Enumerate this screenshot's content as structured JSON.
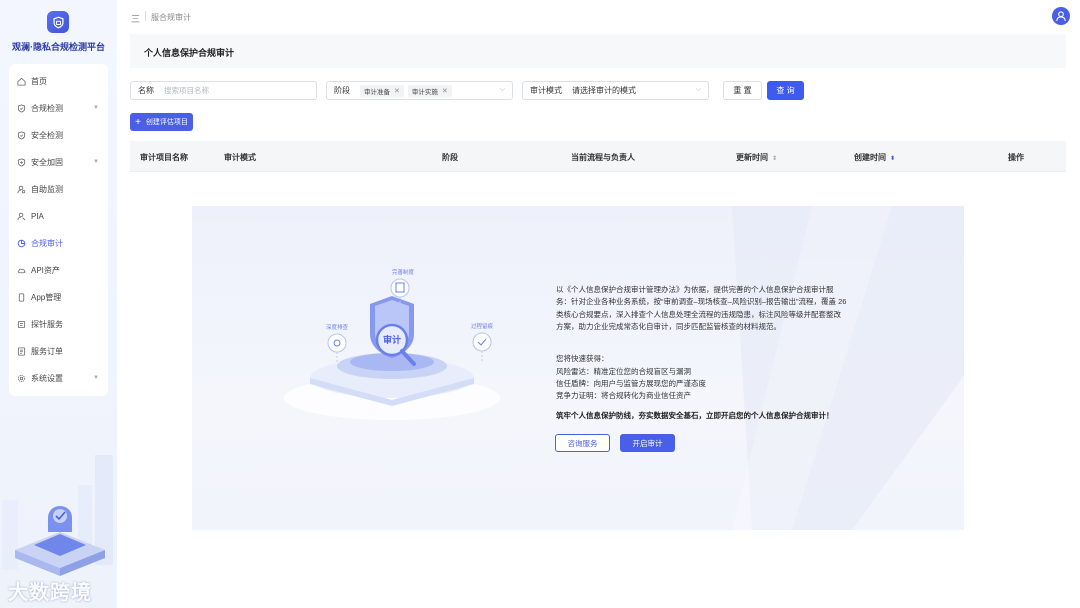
{
  "app": {
    "name": "观澜·隐私合规检测平台",
    "logo_icon": "shield-icon"
  },
  "sidebar": {
    "items": [
      {
        "label": "首页",
        "icon": "home-icon",
        "active": false,
        "expandable": false
      },
      {
        "label": "合规检测",
        "icon": "shield-check-icon",
        "active": false,
        "expandable": true
      },
      {
        "label": "安全检测",
        "icon": "shield-check-icon",
        "active": false,
        "expandable": false
      },
      {
        "label": "安全加固",
        "icon": "shield-plus-icon",
        "active": false,
        "expandable": true
      },
      {
        "label": "自助监测",
        "icon": "user-monitor-icon",
        "active": false,
        "expandable": false
      },
      {
        "label": "PIA",
        "icon": "user-search-icon",
        "active": false,
        "expandable": false
      },
      {
        "label": "合规审计",
        "icon": "audit-icon",
        "active": true,
        "expandable": false
      },
      {
        "label": "API资产",
        "icon": "cloud-icon",
        "active": false,
        "expandable": false
      },
      {
        "label": "App管理",
        "icon": "phone-icon",
        "active": false,
        "expandable": false
      },
      {
        "label": "探针服务",
        "icon": "probe-icon",
        "active": false,
        "expandable": false
      },
      {
        "label": "服务订单",
        "icon": "order-icon",
        "active": false,
        "expandable": false
      },
      {
        "label": "系统设置",
        "icon": "gear-icon",
        "active": false,
        "expandable": true
      }
    ],
    "watermark": "大数跨境"
  },
  "topbar": {
    "menu_glyph": "三",
    "breadcrumb": "服合规审计",
    "avatar_icon": "user-icon"
  },
  "page": {
    "title": "个人信息保护合规审计"
  },
  "filters": {
    "name_label": "名称",
    "name_placeholder": "搜索项目名称",
    "stage_label": "阶段",
    "stage_tags": [
      "审计准备",
      "审计实施"
    ],
    "mode_label": "审计模式",
    "mode_value": "请选择审计的模式",
    "reset_label": "重 置",
    "query_label": "查 询"
  },
  "create_button": {
    "plus": "+",
    "label": "创建评估项目"
  },
  "table": {
    "headers": [
      "审计项目名称",
      "审计模式",
      "阶段",
      "当前流程与负责人",
      "更新时间",
      "创建时间",
      "操作"
    ],
    "sort_glyph": "⇕",
    "sort_active_glyph": "⬍"
  },
  "empty_state": {
    "illus_labels": {
      "top": "完善制度",
      "left": "深度排查",
      "right": "过程留痕",
      "center": "审计"
    },
    "description": "以《个人信息保护合规审计管理办法》为依据，提供完善的个人信息保护合规审计服务：针对企业各种业务系统，按“审前调查–现场核查–风险识别–报告输出”流程，覆盖 26 类核心合规要点，深入排查个人信息处理全流程的违规隐患，标注风险等级并配套整改方案，助力企业完成常态化自审计，同步匹配监管核查的材料规范。",
    "gains_title": "您将快速获得：",
    "gains": [
      "风险雷达：精准定位您的合规盲区与漏洞",
      "信任盾牌：向用户与监管方展现您的严谨态度",
      "竞争力证明：将合规转化为商业信任资产"
    ],
    "slogan": "筑牢个人信息保护防线，夯实数据安全基石，立即开启您的个人信息保护合规审计！",
    "consult_label": "咨询服务",
    "start_label": "开启审计"
  }
}
